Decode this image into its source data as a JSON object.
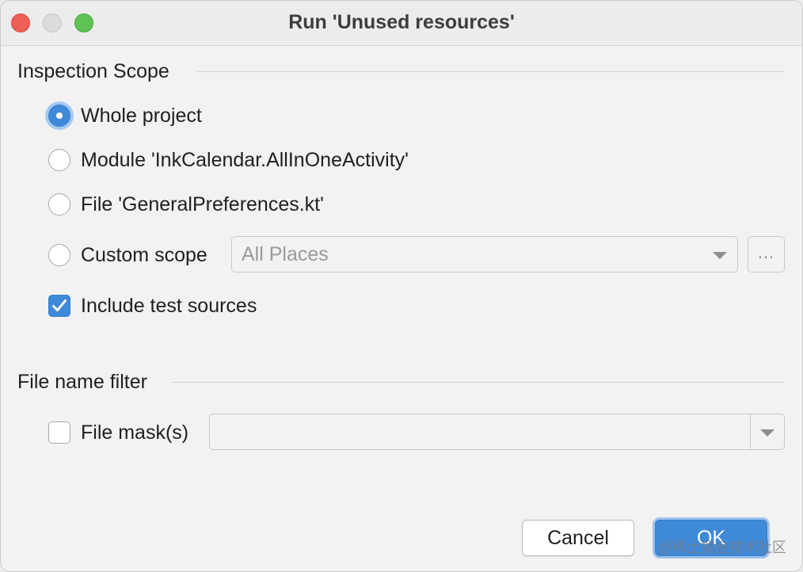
{
  "window": {
    "title": "Run 'Unused resources'"
  },
  "inspection_scope": {
    "header": "Inspection Scope",
    "options": [
      {
        "label": "Whole project",
        "selected": true
      },
      {
        "label": "Module 'InkCalendar.AllInOneActivity'",
        "selected": false
      },
      {
        "label": "File 'GeneralPreferences.kt'",
        "selected": false
      },
      {
        "label": "Custom scope",
        "selected": false
      }
    ],
    "custom_scope_value": "All Places",
    "browse_label": "...",
    "include_test_sources": {
      "label": "Include test sources",
      "checked": true
    }
  },
  "file_name_filter": {
    "header": "File name filter",
    "file_mask": {
      "label": "File mask(s)",
      "checked": false,
      "value": ""
    }
  },
  "buttons": {
    "cancel": "Cancel",
    "ok": "OK"
  },
  "watermark": "@稀土掘金技术社区",
  "colors": {
    "accent": "#3f89d9",
    "close": "#ee5f57",
    "maximize": "#5fc354"
  }
}
